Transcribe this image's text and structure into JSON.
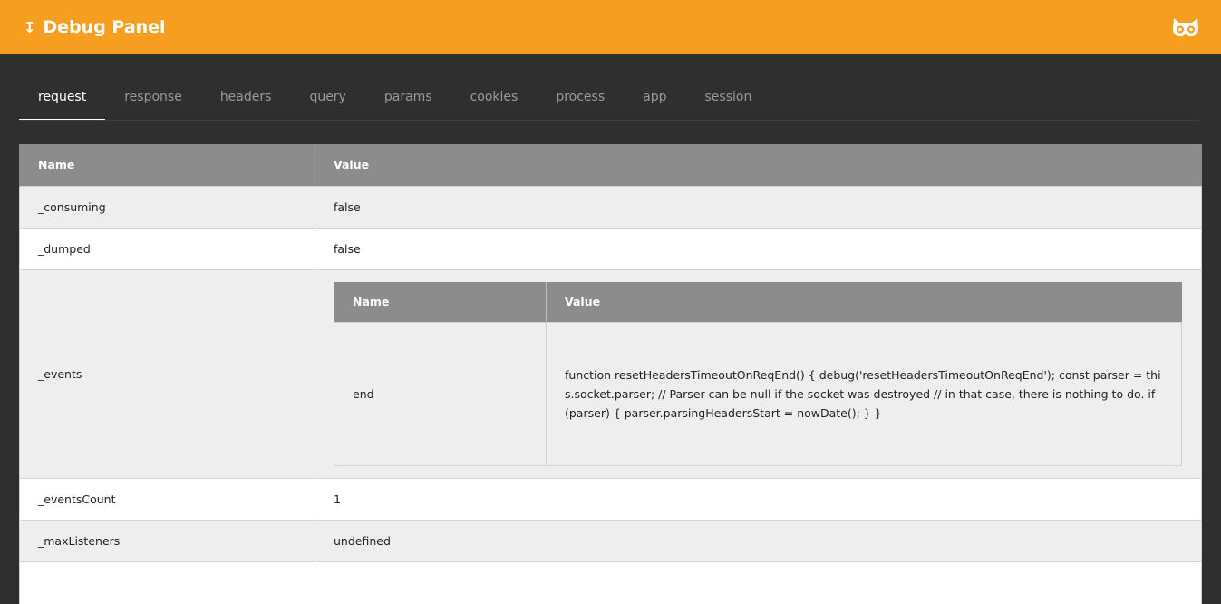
{
  "header": {
    "arrow_glyph": "↧",
    "title": "Debug Panel",
    "logo_icon": "owl-logo-icon",
    "background": "#f59e1f"
  },
  "tabs": [
    {
      "label": "request",
      "active": true
    },
    {
      "label": "response",
      "active": false
    },
    {
      "label": "headers",
      "active": false
    },
    {
      "label": "query",
      "active": false
    },
    {
      "label": "params",
      "active": false
    },
    {
      "label": "cookies",
      "active": false
    },
    {
      "label": "process",
      "active": false
    },
    {
      "label": "app",
      "active": false
    },
    {
      "label": "session",
      "active": false
    }
  ],
  "table": {
    "columns": [
      "Name",
      "Value"
    ],
    "rows": [
      {
        "name": "_consuming",
        "value": "false"
      },
      {
        "name": "_dumped",
        "value": "false"
      },
      {
        "name": "_events",
        "nested": {
          "columns": [
            "Name",
            "Value"
          ],
          "rows": [
            {
              "name": "end",
              "value": "function resetHeadersTimeoutOnReqEnd() { debug('resetHeadersTimeoutOnReqEnd'); const parser = this.socket.parser; // Parser can be null if the socket was destroyed // in that case, there is nothing to do. if (parser) { parser.parsingHeadersStart = nowDate(); } }"
            }
          ]
        }
      },
      {
        "name": "_eventsCount",
        "value": "1"
      },
      {
        "name": "_maxListeners",
        "value": "undefined"
      },
      {
        "name": "",
        "value": ""
      }
    ]
  }
}
